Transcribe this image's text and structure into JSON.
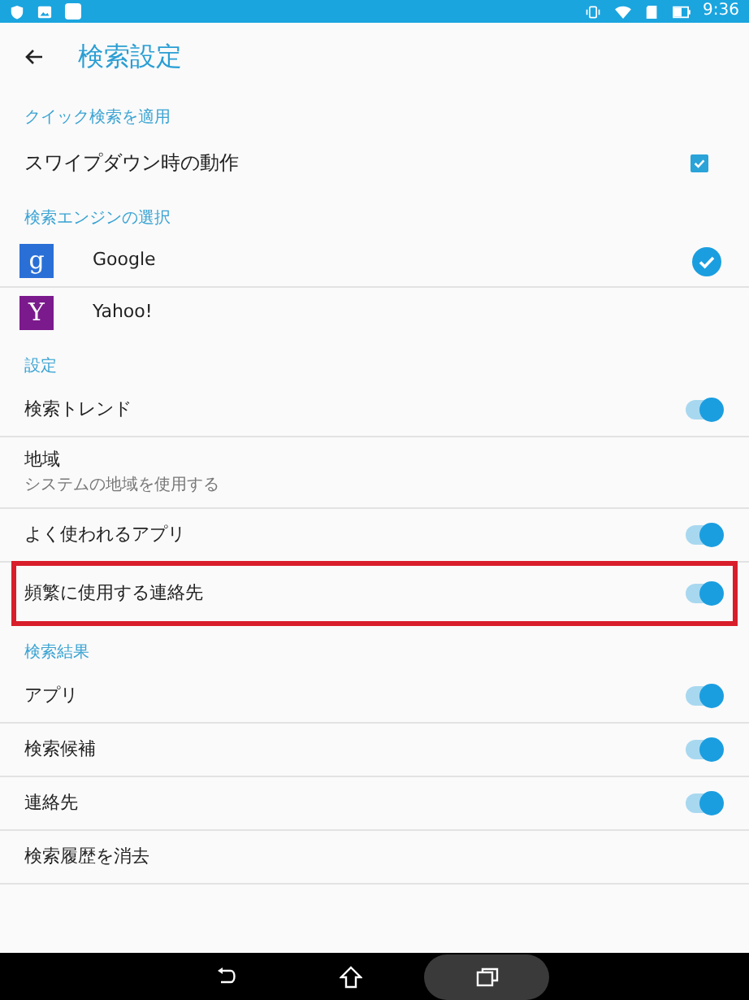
{
  "status_bar": {
    "time": "9:36"
  },
  "header": {
    "title": "検索設定"
  },
  "sections": [
    {
      "title": "クイック検索を適用",
      "items": [
        {
          "kind": "checkbox",
          "label": "スワイプダウン時の動作",
          "checked": true,
          "highlighted": false
        }
      ]
    },
    {
      "title": "検索エンジンの選択",
      "items": [
        {
          "kind": "engine",
          "label": "Google",
          "logo_letter": "g",
          "color": "#2a6fd6",
          "selected": true,
          "highlighted": false
        },
        {
          "kind": "engine",
          "label": "Yahoo!",
          "logo_letter": "Y",
          "color": "#7b1a8c",
          "selected": false,
          "highlighted": false
        }
      ]
    },
    {
      "title": "設定",
      "items": [
        {
          "kind": "toggle",
          "label": "検索トレンド",
          "on": true,
          "highlighted": false
        },
        {
          "kind": "detail",
          "label": "地域",
          "subtitle": "システムの地域を使用する",
          "highlighted": false
        },
        {
          "kind": "toggle",
          "label": "よく使われるアプリ",
          "on": true,
          "highlighted": false
        },
        {
          "kind": "toggle",
          "label": "頻繁に使用する連絡先",
          "on": true,
          "highlighted": true
        }
      ]
    },
    {
      "title": "検索結果",
      "items": [
        {
          "kind": "toggle",
          "label": "アプリ",
          "on": true,
          "highlighted": false
        },
        {
          "kind": "toggle",
          "label": "検索候補",
          "on": true,
          "highlighted": false
        },
        {
          "kind": "toggle",
          "label": "連絡先",
          "on": true,
          "highlighted": false
        },
        {
          "kind": "action",
          "label": "検索履歴を消去",
          "highlighted": false
        }
      ]
    }
  ]
}
